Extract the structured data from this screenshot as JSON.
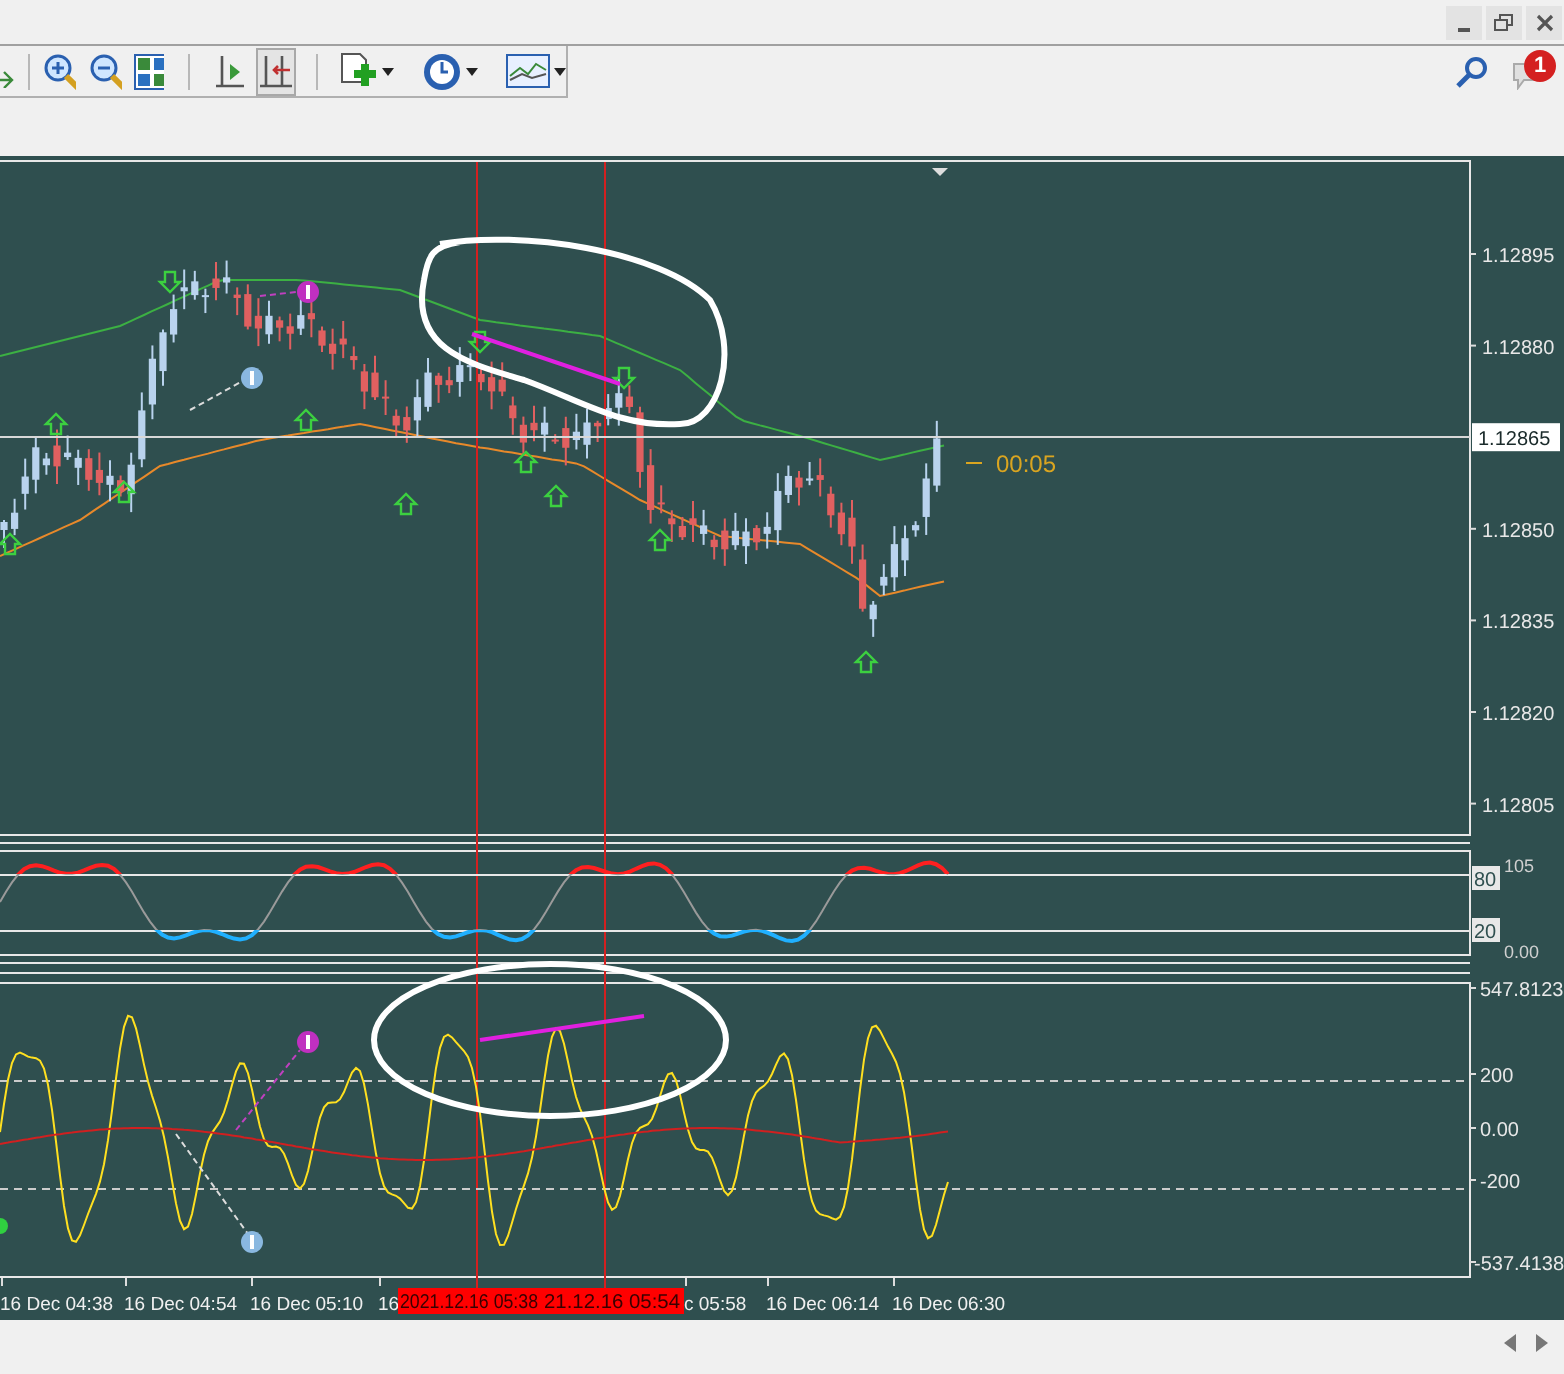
{
  "notifications": {
    "badge": "1"
  },
  "price_axis": [
    {
      "text": "1.12895",
      "kind": "tick"
    },
    {
      "text": "1.12880",
      "kind": "tick"
    },
    {
      "text": "1.12865",
      "kind": "current"
    },
    {
      "text": "1.12850",
      "kind": "tick"
    },
    {
      "text": "1.12835",
      "kind": "tick"
    },
    {
      "text": "1.12820",
      "kind": "tick"
    },
    {
      "text": "1.12805",
      "kind": "tick"
    }
  ],
  "countdown": "00:05",
  "rsi_axis": [
    {
      "text": "105",
      "kind": "scale"
    },
    {
      "text": "80",
      "kind": "level"
    },
    {
      "text": "20",
      "kind": "level"
    },
    {
      "text": "0.00",
      "kind": "scale"
    }
  ],
  "oscillator_axis": [
    "547.8123",
    "200",
    "0.00",
    "-200",
    "-537.4138"
  ],
  "time_axis": [
    {
      "text": "16 Dec 04:38",
      "kind": "tick"
    },
    {
      "text": "16 Dec 04:54",
      "kind": "tick"
    },
    {
      "text": "16 Dec 05:10",
      "kind": "tick"
    },
    {
      "text": "16",
      "kind": "tick"
    },
    {
      "text": "2021.12.16 05:38",
      "kind": "marker"
    },
    {
      "text": "21.12.16 05:54",
      "kind": "marker"
    },
    {
      "text": "c 05:58",
      "kind": "tick"
    },
    {
      "text": "16 Dec 06:14",
      "kind": "tick"
    },
    {
      "text": "16 Dec 06:30",
      "kind": "tick"
    }
  ]
}
